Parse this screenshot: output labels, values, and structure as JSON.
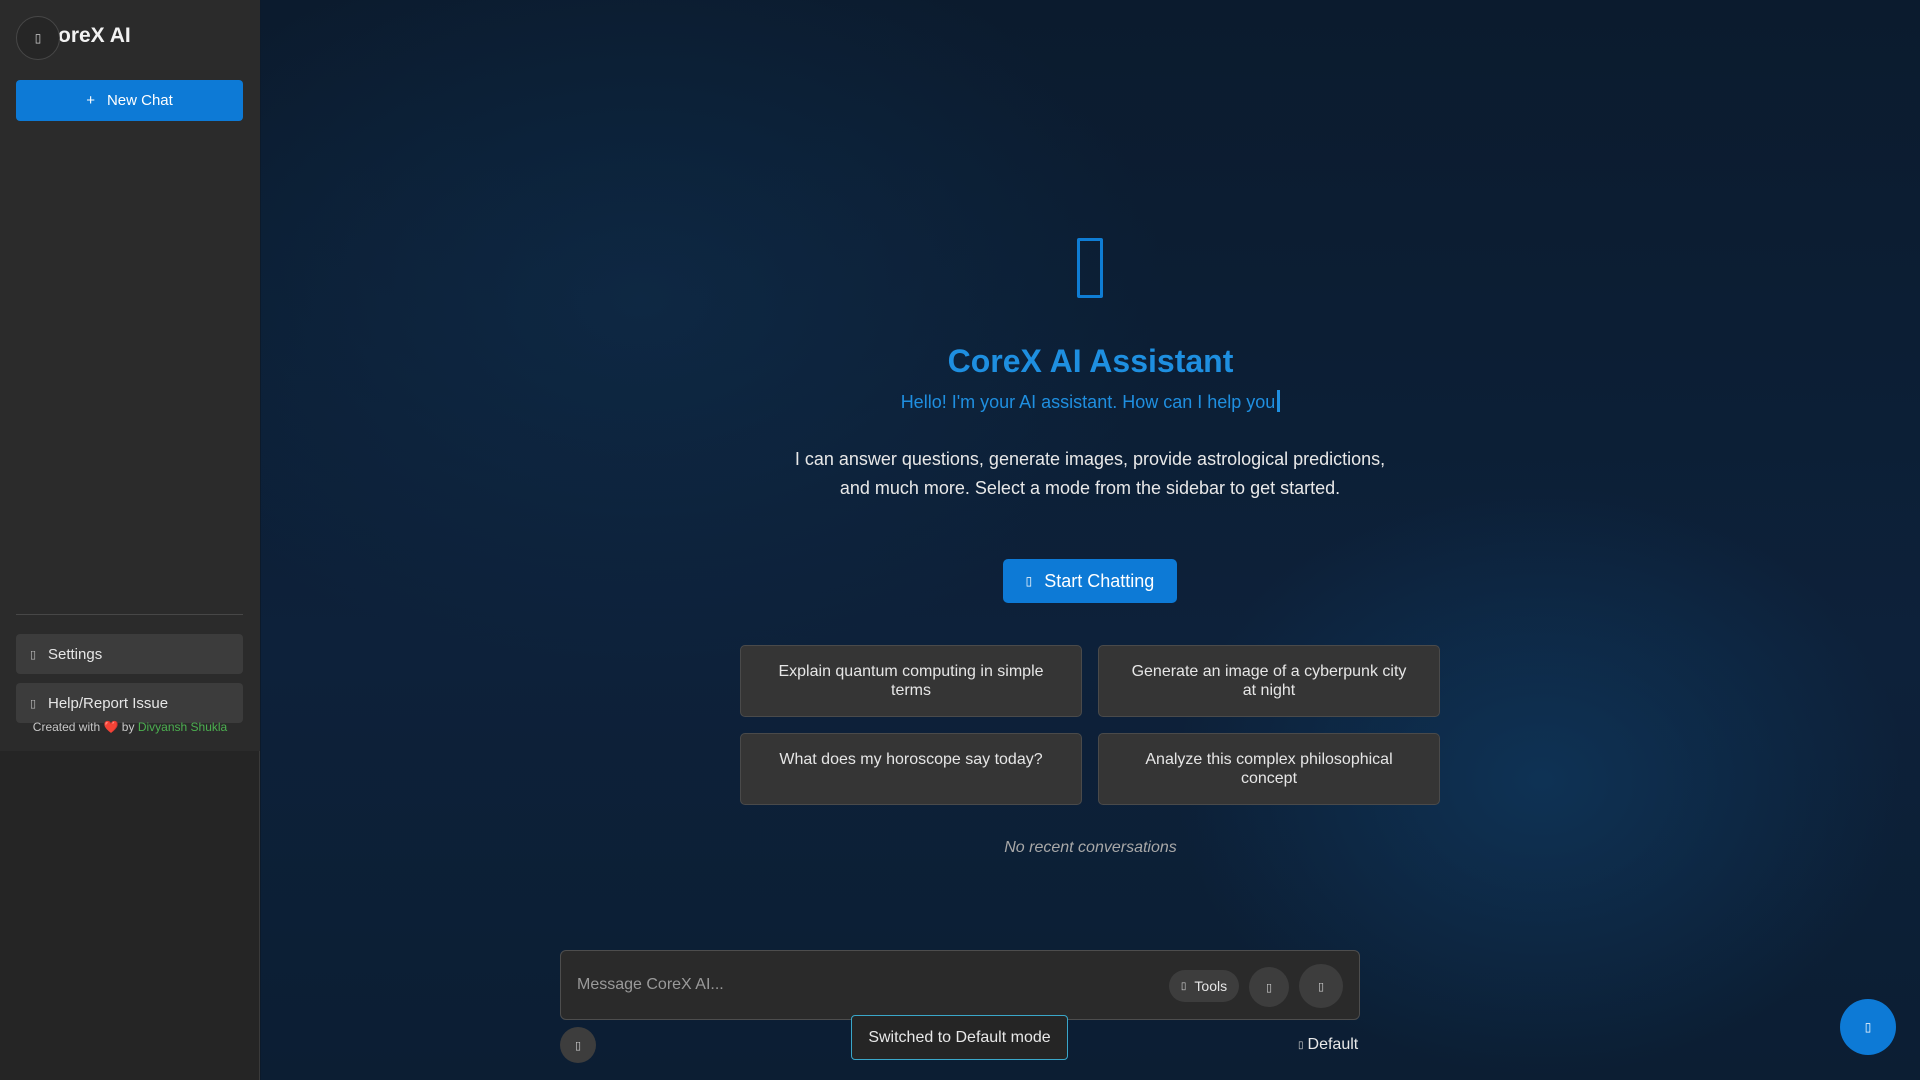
{
  "sidebar": {
    "logo_text": "oreX AI",
    "menu_glyph": "▯",
    "new_chat": {
      "icon": "+",
      "label": "New Chat"
    },
    "settings": {
      "icon": "▯",
      "label": "Settings"
    },
    "help": {
      "icon": "▯",
      "label": "Help/Report Issue"
    },
    "credit": {
      "prefix": "Created with",
      "heart": "❤️",
      "by": "by",
      "author": "Divyansh Shukla"
    }
  },
  "hero": {
    "title": "CoreX AI Assistant",
    "subtitle": "Hello! I'm your AI assistant. How can I help you",
    "description": "I can answer questions, generate images, provide astrological predictions, and much more. Select a mode from the sidebar to get started.",
    "start_button": {
      "icon": "▯",
      "label": "Start Chatting"
    }
  },
  "suggestions": [
    "Explain quantum computing in simple terms",
    "Generate an image of a cyberpunk city at night",
    "What does my horoscope say today?",
    "Analyze this complex philosophical concept"
  ],
  "recent": {
    "empty_text": "No recent conversations"
  },
  "composer": {
    "placeholder": "Message CoreX AI...",
    "tools": {
      "icon": "▯",
      "label": "Tools"
    },
    "voice_glyph": "▯",
    "send_glyph": "▯",
    "attach_glyph": "▯",
    "mode": {
      "icon": "▯",
      "label": "Default"
    }
  },
  "toast": {
    "text": "Switched to Default mode"
  },
  "fab_glyph": "▯",
  "colors": {
    "accent": "#0d7ad6",
    "title": "#1e8fe0",
    "sidebar_bg": "#2b2b2b",
    "card_bg": "#353535",
    "heart": "#e53935",
    "author": "#4caf50",
    "toast_border": "#3aa7c9"
  }
}
